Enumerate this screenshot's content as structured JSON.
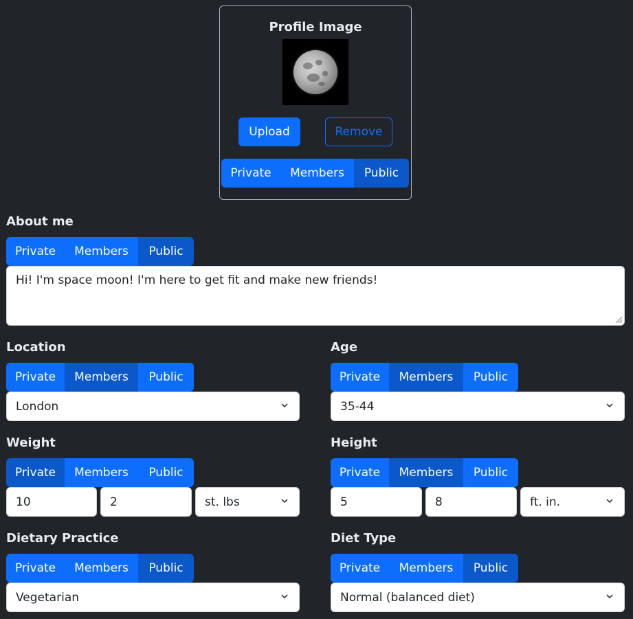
{
  "profile": {
    "title": "Profile Image",
    "upload_label": "Upload",
    "remove_label": "Remove"
  },
  "privacy_options": [
    "Private",
    "Members",
    "Public"
  ],
  "about": {
    "label": "About me",
    "value": "Hi! I'm space moon! I'm here to get fit and make new friends!"
  },
  "location": {
    "label": "Location",
    "value": "London"
  },
  "age": {
    "label": "Age",
    "value": "35-44"
  },
  "weight": {
    "label": "Weight",
    "stones": "10",
    "pounds": "2",
    "unit": "st. lbs"
  },
  "height": {
    "label": "Height",
    "feet": "5",
    "inches": "8",
    "unit": "ft. in."
  },
  "dietary_practice": {
    "label": "Dietary Practice",
    "value": "Vegetarian"
  },
  "diet_type": {
    "label": "Diet Type",
    "value": "Normal (balanced diet)"
  },
  "colors": {
    "background": "#212529",
    "primary": "#0d6efd",
    "primary_active": "#0a58ca"
  }
}
